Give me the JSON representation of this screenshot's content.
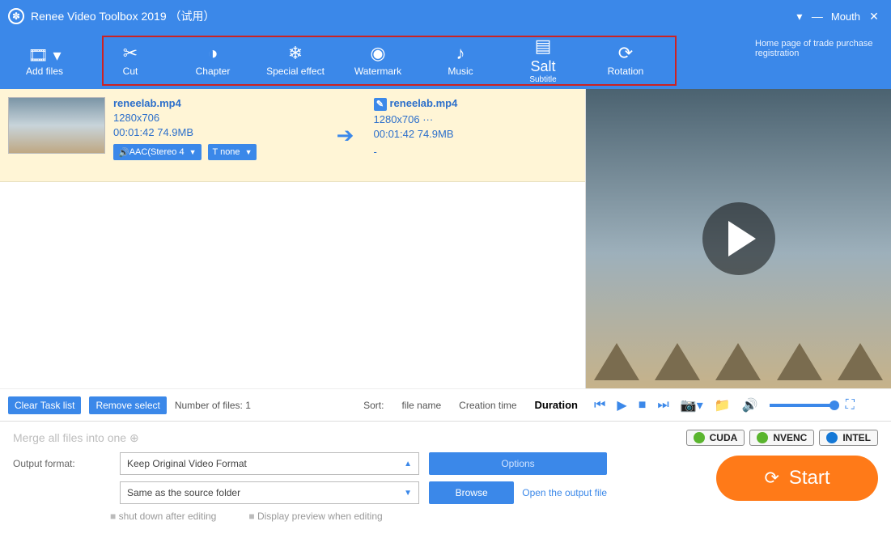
{
  "title": "Renee Video Toolbox 2019 （试用）",
  "sys": {
    "mouth": "Mouth"
  },
  "toolbar": {
    "add": "Add files",
    "homepage": "Home page of trade purchase registration",
    "tabs": [
      {
        "label": "Cut",
        "icon": "✂"
      },
      {
        "label": "Chapter",
        "icon": "◑"
      },
      {
        "label": "Special effect",
        "icon": "❄"
      },
      {
        "label": "Watermark",
        "icon": "◉"
      },
      {
        "label": "Music",
        "icon": "♪"
      },
      {
        "label": "Salt",
        "sub": "Subtitle",
        "icon": "▤"
      },
      {
        "label": "Rotation",
        "icon": "⟳"
      }
    ]
  },
  "file": {
    "in": {
      "name": "reneelab.mp4",
      "res": "1280x706",
      "dur": "00:01:42  74.9MB",
      "audio_sel": "AAC(Stereo 4",
      "sub_sel": "T none"
    },
    "out": {
      "name": "reneelab.mp4",
      "res": "1280x706   ···",
      "dur": "00:01:42  74.9MB",
      "dash": "-"
    }
  },
  "listfooter": {
    "clear": "Clear Task list",
    "remove": "Remove select",
    "count_label": "Number of files: 1",
    "sort_label": "Sort:",
    "sort_name": "file name",
    "sort_ctime": "Creation time",
    "sort_dur": "Duration"
  },
  "bottom": {
    "merge": "Merge all files into one",
    "output_label": "Output format:",
    "output_format": "Keep Original Video Format",
    "dest": "Same as the source folder",
    "options": "Options",
    "browse": "Browse",
    "open_output": "Open the output file",
    "accel": {
      "cuda": "CUDA",
      "nvenc": "NVENC",
      "intel": "INTEL"
    },
    "start": "Start",
    "chk_shutdown": "shut down after editing",
    "chk_preview": "Display preview when editing"
  }
}
